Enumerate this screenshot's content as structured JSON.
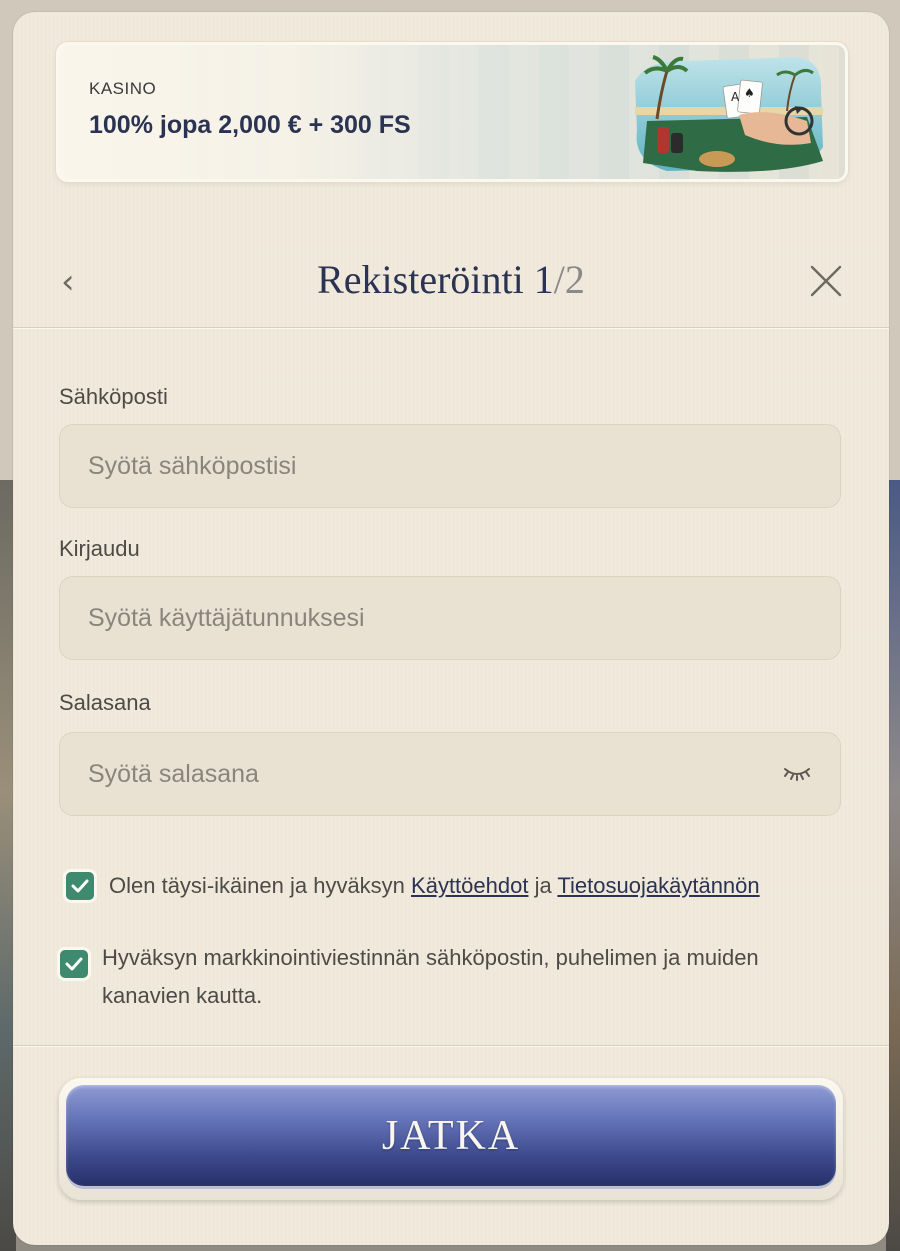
{
  "banner": {
    "category": "KASINO",
    "offer": "100% jopa 2,000 € + 300 FS"
  },
  "header": {
    "back_icon": "chevron-left-icon",
    "title_main": "Rekisteröinti 1",
    "title_suffix": "/2",
    "close_icon": "close-icon"
  },
  "form": {
    "email": {
      "label": "Sähköposti",
      "placeholder": "Syötä sähköpostisi",
      "value": ""
    },
    "username": {
      "label": "Kirjaudu",
      "placeholder": "Syötä käyttäjätunnuksesi",
      "value": ""
    },
    "password": {
      "label": "Salasana",
      "placeholder": "Syötä salasana",
      "value": "",
      "toggle_icon": "eye-closed-icon"
    }
  },
  "consents": {
    "terms": {
      "checked": true,
      "text_before": "Olen täysi-ikäinen ja hyväksyn ",
      "link1": "Käyttöehdot",
      "text_between": " ja ",
      "link2": "Tietosuojakäytännön"
    },
    "marketing": {
      "checked": true,
      "text_line1": "Hyväksyn markkinointiviestinnän sähköpostin, puhelimen ja muiden",
      "text_line2": "kanavien kautta."
    }
  },
  "cta": {
    "label": "JATKA"
  },
  "colors": {
    "accent_navy": "#2a3352",
    "checkbox_green": "#3d8a6e",
    "modal_bg": "#f1eadc",
    "button_blue": "#3d4a8e"
  }
}
